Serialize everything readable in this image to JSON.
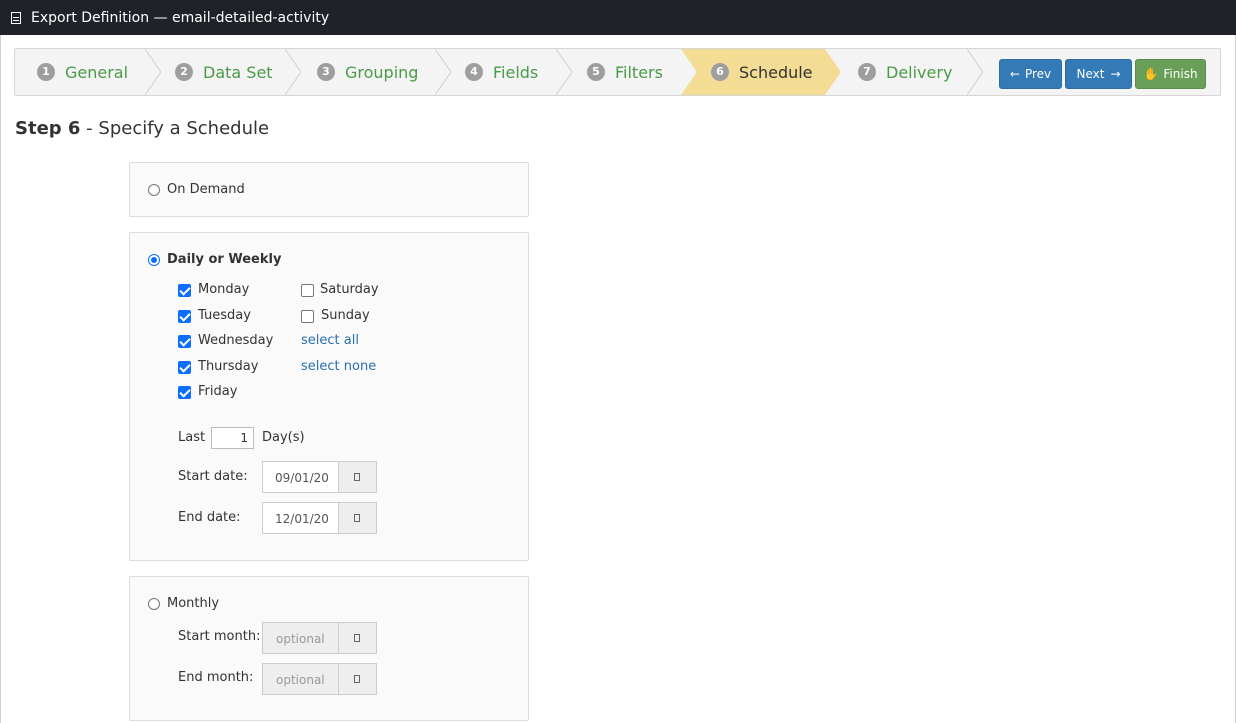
{
  "window": {
    "title": "Export Definition — email-detailed-activity"
  },
  "wizard": {
    "steps": [
      {
        "num": "1",
        "label": "General"
      },
      {
        "num": "2",
        "label": "Data Set"
      },
      {
        "num": "3",
        "label": "Grouping"
      },
      {
        "num": "4",
        "label": "Fields"
      },
      {
        "num": "5",
        "label": "Filters"
      },
      {
        "num": "6",
        "label": "Schedule"
      },
      {
        "num": "7",
        "label": "Delivery"
      }
    ],
    "active_step": "Schedule",
    "prev_label": "Prev",
    "next_label": "Next",
    "finish_label": "Finish",
    "colors": {
      "active": "#f3dc93",
      "link": "#4a9a48",
      "primary": "#337ab7",
      "success": "#6a9f5a"
    }
  },
  "page": {
    "step_label": "Step 6",
    "title": " - Specify a Schedule"
  },
  "on_demand": {
    "label": "On Demand",
    "selected": false
  },
  "daily_weekly": {
    "label": "Daily or Weekly",
    "selected": true,
    "days": [
      {
        "label": "Monday",
        "checked": true
      },
      {
        "label": "Tuesday",
        "checked": true
      },
      {
        "label": "Wednesday",
        "checked": true
      },
      {
        "label": "Thursday",
        "checked": true
      },
      {
        "label": "Friday",
        "checked": true
      },
      {
        "label": "Saturday",
        "checked": false
      },
      {
        "label": "Sunday",
        "checked": false
      }
    ],
    "select_all": "select all",
    "select_none": "select none",
    "last_label": "Last",
    "last_value": "1",
    "days_unit": "Day(s)",
    "start_label": "Start date:",
    "start_value": "09/01/20",
    "end_label": "End date:",
    "end_value": "12/01/20"
  },
  "monthly": {
    "label": "Monthly",
    "selected": false,
    "start_label": "Start month:",
    "start_placeholder": "optional",
    "end_label": "End month:",
    "end_placeholder": "optional"
  }
}
